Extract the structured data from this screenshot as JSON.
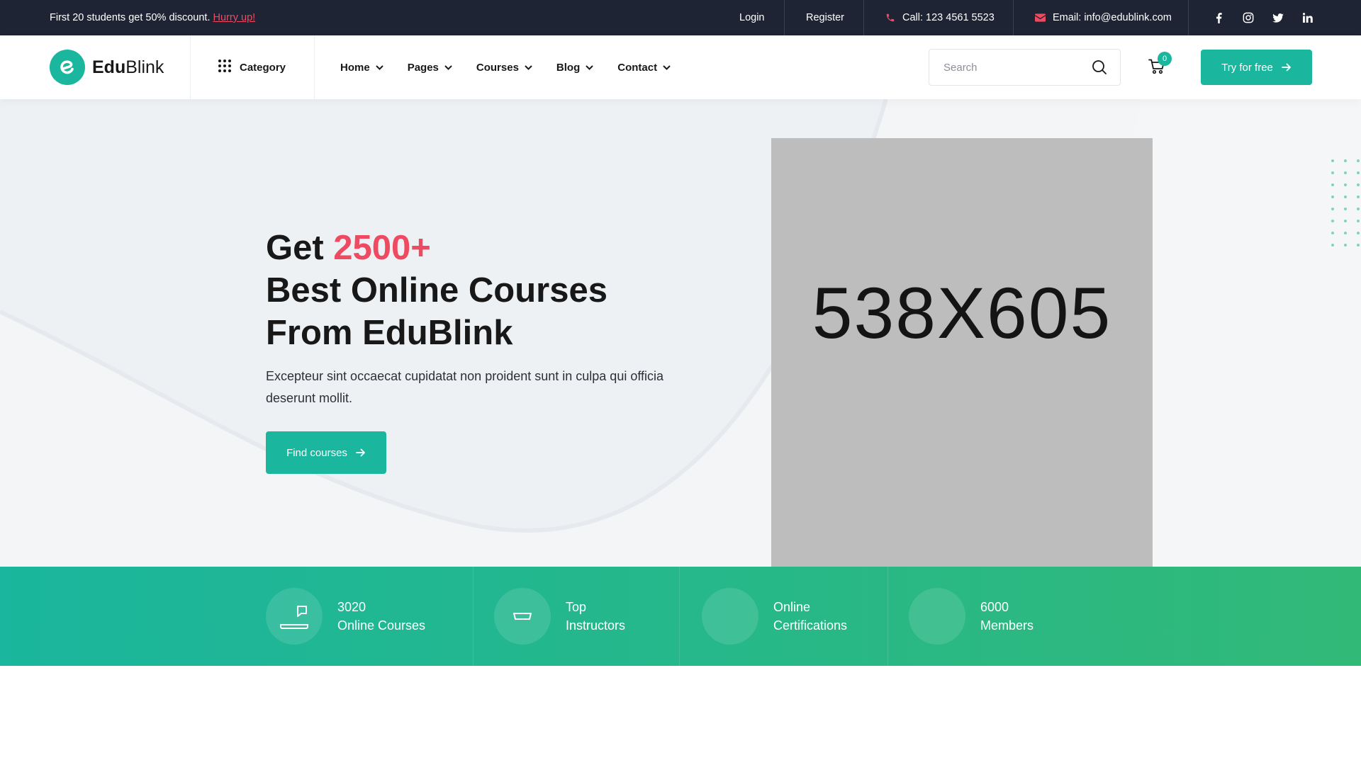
{
  "topbar": {
    "promo_text": "First 20 students get 50% discount.",
    "promo_link": "Hurry up!",
    "login": "Login",
    "register": "Register",
    "phone": "Call: 123 4561 5523",
    "email": "Email: info@edublink.com"
  },
  "header": {
    "logo_bold": "Edu",
    "logo_light": "Blink",
    "category": "Category",
    "nav": [
      "Home",
      "Pages",
      "Courses",
      "Blog",
      "Contact"
    ],
    "search_placeholder": "Search",
    "cart_count": "0",
    "try_button": "Try for free"
  },
  "hero": {
    "title_prefix": "Get ",
    "title_accent": "2500+",
    "title_line2": "Best Online Courses",
    "title_line3": "From EduBlink",
    "description": "Excepteur sint occaecat cupidatat non proident sunt in culpa qui officia deserunt mollit.",
    "find_button": "Find courses",
    "image_placeholder": "538X605"
  },
  "stats": [
    {
      "line1": "3020",
      "line2": "Online Courses"
    },
    {
      "line1": "Top",
      "line2": "Instructors"
    },
    {
      "line1": "Online",
      "line2": "Certifications"
    },
    {
      "line1": "6000",
      "line2": "Members"
    }
  ],
  "colors": {
    "primary": "#1ab69d",
    "accent": "#ee4a62",
    "topbar_bg": "#1e2434"
  }
}
